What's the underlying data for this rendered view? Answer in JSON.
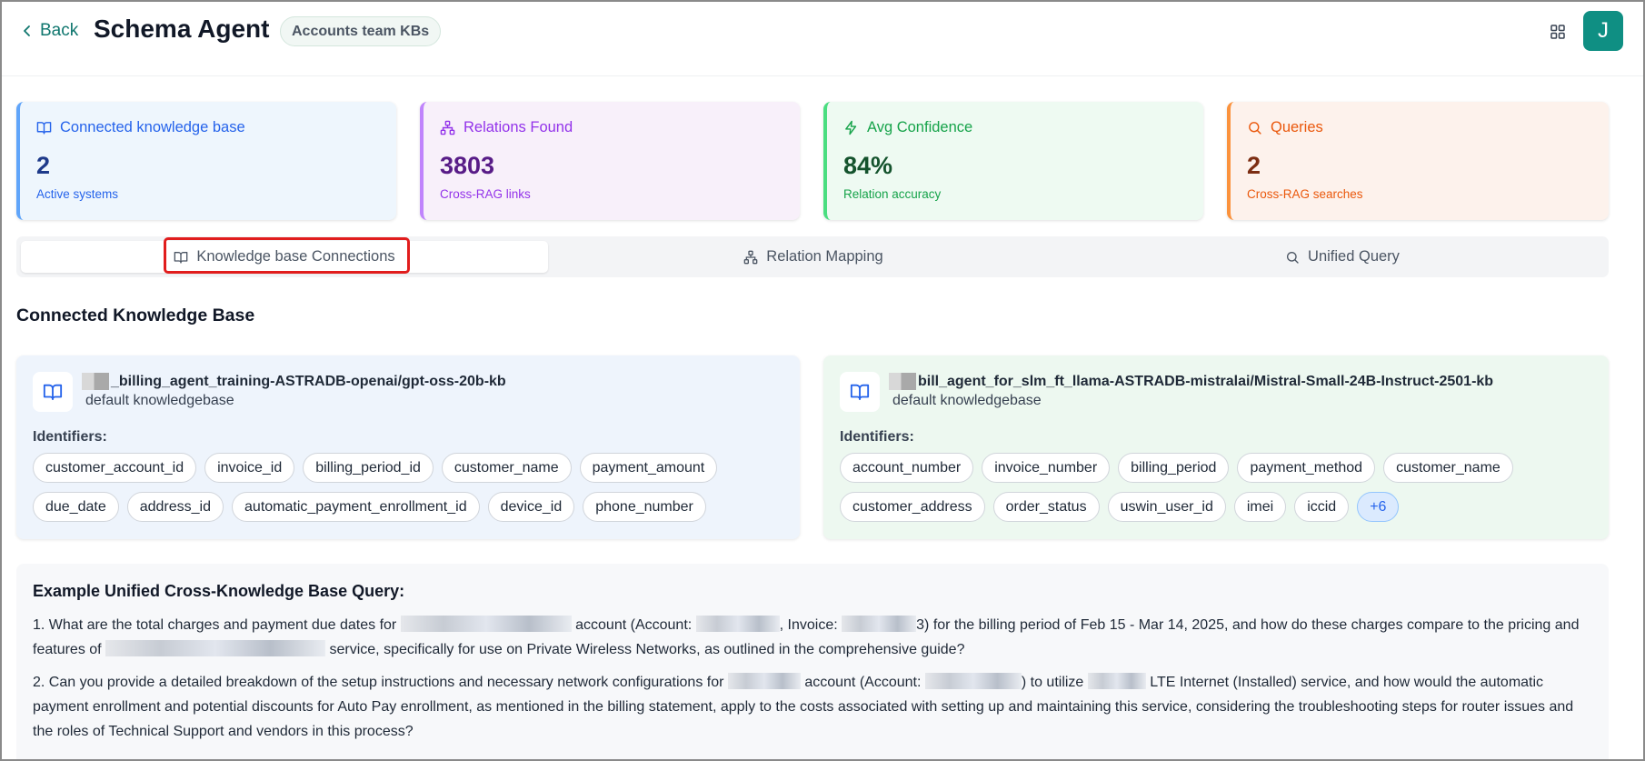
{
  "header": {
    "back_label": "Back",
    "title": "Schema Agent",
    "badge": "Accounts team KBs",
    "avatar_letter": "J"
  },
  "stats": [
    {
      "label": "Connected knowledge base",
      "value": "2",
      "sub": "Active systems",
      "icon": "book-open-icon"
    },
    {
      "label": "Relations Found",
      "value": "3803",
      "sub": "Cross-RAG links",
      "icon": "network-icon"
    },
    {
      "label": "Avg Confidence",
      "value": "84%",
      "sub": "Relation accuracy",
      "icon": "zap-icon"
    },
    {
      "label": "Queries",
      "value": "2",
      "sub": "Cross-RAG searches",
      "icon": "search-icon"
    }
  ],
  "tabs": [
    {
      "label": "Knowledge base Connections",
      "active": true,
      "icon": "book-open-icon"
    },
    {
      "label": "Relation Mapping",
      "active": false,
      "icon": "network-icon"
    },
    {
      "label": "Unified Query",
      "active": false,
      "icon": "search-icon"
    }
  ],
  "section_title": "Connected Knowledge Base",
  "knowledge_bases": [
    {
      "name": "_billing_agent_training-ASTRADB-openai/gpt-oss-20b-kb",
      "type": "default knowledgebase",
      "identifiers_label": "Identifiers:",
      "identifiers": [
        "customer_account_id",
        "invoice_id",
        "billing_period_id",
        "customer_name",
        "payment_amount",
        "due_date",
        "address_id",
        "automatic_payment_enrollment_id",
        "device_id",
        "phone_number"
      ]
    },
    {
      "name": "bill_agent_for_slm_ft_llama-ASTRADB-mistralai/Mistral-Small-24B-Instruct-2501-kb",
      "type": "default knowledgebase",
      "identifiers_label": "Identifiers:",
      "identifiers": [
        "account_number",
        "invoice_number",
        "billing_period",
        "payment_method",
        "customer_name",
        "customer_address",
        "order_status",
        "uswin_user_id",
        "imei",
        "iccid"
      ],
      "more": "+6"
    }
  ],
  "query": {
    "title": "Example Unified Cross-Knowledge Base Query:",
    "q1": {
      "a": "1. What are the total charges and payment due dates for ",
      "b": " account (Account: ",
      "c": ", Invoice: ",
      "d": "3) for the billing period of Feb 15 - Mar 14, 2025, and how do these charges compare to the pricing and features of ",
      "e": " service, specifically for use on Private Wireless Networks, as outlined in the comprehensive guide?"
    },
    "q2": {
      "a": "2. Can you provide a detailed breakdown of the setup instructions and necessary network configurations for ",
      "b": " account (Account: ",
      "c": ") to utilize ",
      "d": " LTE Internet (Installed) service, and how would the automatic payment enrollment and potential discounts for Auto Pay enrollment, as mentioned in the billing statement, apply to the costs associated with setting up and maintaining this service, considering the troubleshooting steps for router issues and the roles of Technical Support and vendors in this process?"
    }
  }
}
